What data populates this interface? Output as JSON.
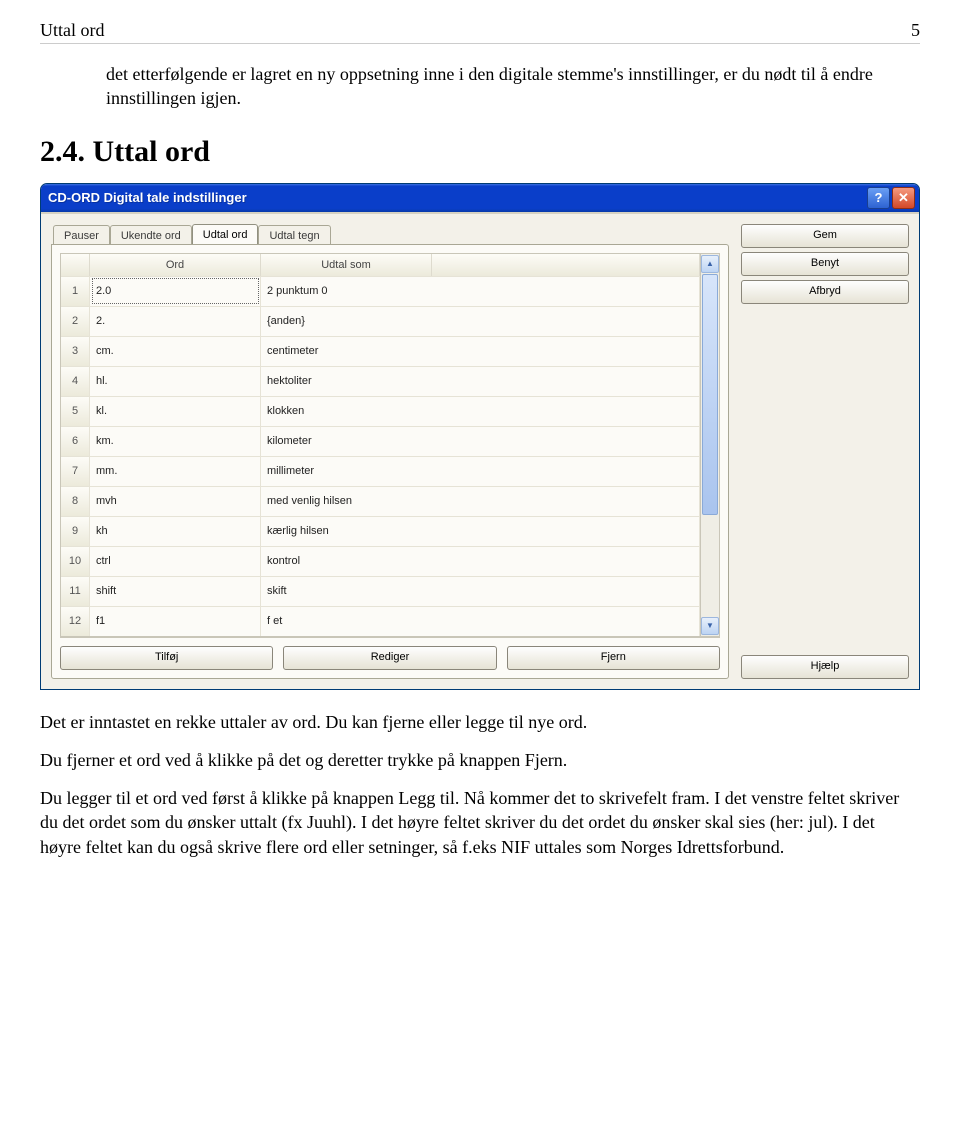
{
  "page_header": {
    "title": "Uttal ord",
    "page_number": "5"
  },
  "intro_text": "det etterfølgende er lagret en ny oppsetning inne i den digitale stemme's innstillinger, er du nødt til å endre innstillingen igjen.",
  "section_heading": "2.4. Uttal ord",
  "window": {
    "title": "CD-ORD Digital tale indstillinger",
    "help_glyph": "?",
    "close_glyph": "✕",
    "tabs": [
      "Pauser",
      "Ukendte ord",
      "Udtal ord",
      "Udtal tegn"
    ],
    "active_tab_index": 2,
    "side_buttons": {
      "gem": "Gem",
      "benyt": "Benyt",
      "afbryd": "Afbryd",
      "hjaelp": "Hjælp"
    },
    "columns": {
      "rownum": "",
      "ord": "Ord",
      "udtal": "Udtal som",
      "empty": ""
    },
    "rows": [
      {
        "n": "1",
        "ord": "2.0",
        "udtal": "2 punktum 0"
      },
      {
        "n": "2",
        "ord": "2.",
        "udtal": "{anden}"
      },
      {
        "n": "3",
        "ord": "cm.",
        "udtal": "centimeter"
      },
      {
        "n": "4",
        "ord": "hl.",
        "udtal": "hektoliter"
      },
      {
        "n": "5",
        "ord": "kl.",
        "udtal": "klokken"
      },
      {
        "n": "6",
        "ord": "km.",
        "udtal": "kilometer"
      },
      {
        "n": "7",
        "ord": "mm.",
        "udtal": "millimeter"
      },
      {
        "n": "8",
        "ord": "mvh",
        "udtal": "med venlig hilsen"
      },
      {
        "n": "9",
        "ord": "kh",
        "udtal": "kærlig hilsen"
      },
      {
        "n": "10",
        "ord": "ctrl",
        "udtal": "kontrol"
      },
      {
        "n": "11",
        "ord": "shift",
        "udtal": "skift"
      },
      {
        "n": "12",
        "ord": "f1",
        "udtal": "f et"
      }
    ],
    "bottom_buttons": {
      "tilfoj": "Tilføj",
      "rediger": "Rediger",
      "fjern": "Fjern"
    },
    "scroll_up": "▲",
    "scroll_down": "▼"
  },
  "after_text": {
    "p1": "Det er inntastet en rekke uttaler av ord. Du kan fjerne eller legge til nye ord.",
    "p2": "Du fjerner et ord ved å klikke på det og deretter trykke på knappen Fjern.",
    "p3": "Du legger til et ord ved først å klikke på knappen Legg til. Nå kommer det to skrivefelt fram. I det venstre feltet skriver du det ordet som du ønsker uttalt (fx Juuhl). I det høyre feltet skriver du det ordet du ønsker skal sies (her: jul). I det høyre feltet kan du også skrive flere ord eller setninger, så f.eks NIF uttales som Norges Idrettsforbund."
  }
}
